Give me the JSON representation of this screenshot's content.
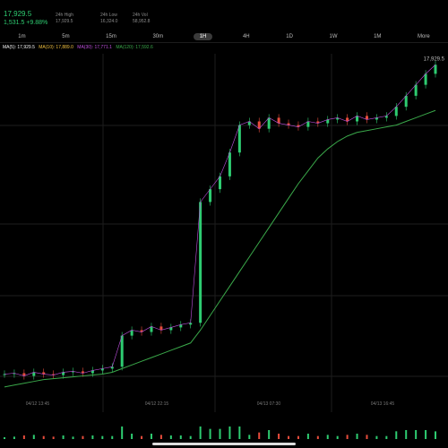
{
  "header": {
    "price": "17,929.5",
    "change": "1,531.5 +9.88%",
    "stats": [
      {
        "label": "24h High",
        "value": "17,929.5"
      },
      {
        "label": "24h Low",
        "value": "16,324.0"
      },
      {
        "label": "24h Vol",
        "value": "58,952.8"
      }
    ]
  },
  "tabs": [
    "1m",
    "5m",
    "15m",
    "30m",
    "1H",
    "4H",
    "1D",
    "1W",
    "1M",
    "More"
  ],
  "active_tab": 4,
  "legend": [
    {
      "label": "MA(5): 17,929.5",
      "color": "#f5f5f5"
    },
    {
      "label": "MA(10): 17,889.0",
      "color": "#f0c040"
    },
    {
      "label": "MA(30): 17,771.1",
      "color": "#c050e0"
    },
    {
      "label": "MA(120): 17,592.6",
      "color": "#3aa84a"
    }
  ],
  "colors": {
    "up": "#2ecc71",
    "down": "#e74c3c",
    "grid": "#1e1e1e"
  },
  "chart_data": {
    "type": "line",
    "description_type": "candlestick",
    "ylabel_right": "17,929.5",
    "x_labels": [
      "04/12 13:45",
      "04/12 22:15",
      "04/13 07:30",
      "04/13 16:45"
    ],
    "close": [
      16240,
      16245,
      16230,
      16250,
      16240,
      16235,
      16250,
      16255,
      16245,
      16260,
      16270,
      16280,
      16450,
      16480,
      16470,
      16500,
      16480,
      16495,
      16510,
      16520,
      17180,
      17250,
      17320,
      17450,
      17600,
      17620,
      17580,
      17640,
      17610,
      17600,
      17590,
      17620,
      17610,
      17630,
      17640,
      17620,
      17650,
      17630,
      17640,
      17650,
      17700,
      17760,
      17820,
      17880,
      17929.5
    ],
    "ma120": [
      16170,
      16180,
      16190,
      16200,
      16210,
      16215,
      16220,
      16225,
      16230,
      16235,
      16240,
      16250,
      16270,
      16290,
      16310,
      16330,
      16350,
      16370,
      16390,
      16410,
      16480,
      16560,
      16640,
      16720,
      16800,
      16880,
      16960,
      17040,
      17120,
      17200,
      17280,
      17350,
      17420,
      17470,
      17510,
      17540,
      17560,
      17570,
      17580,
      17590,
      17600,
      17620,
      17640,
      17660,
      17680
    ]
  }
}
